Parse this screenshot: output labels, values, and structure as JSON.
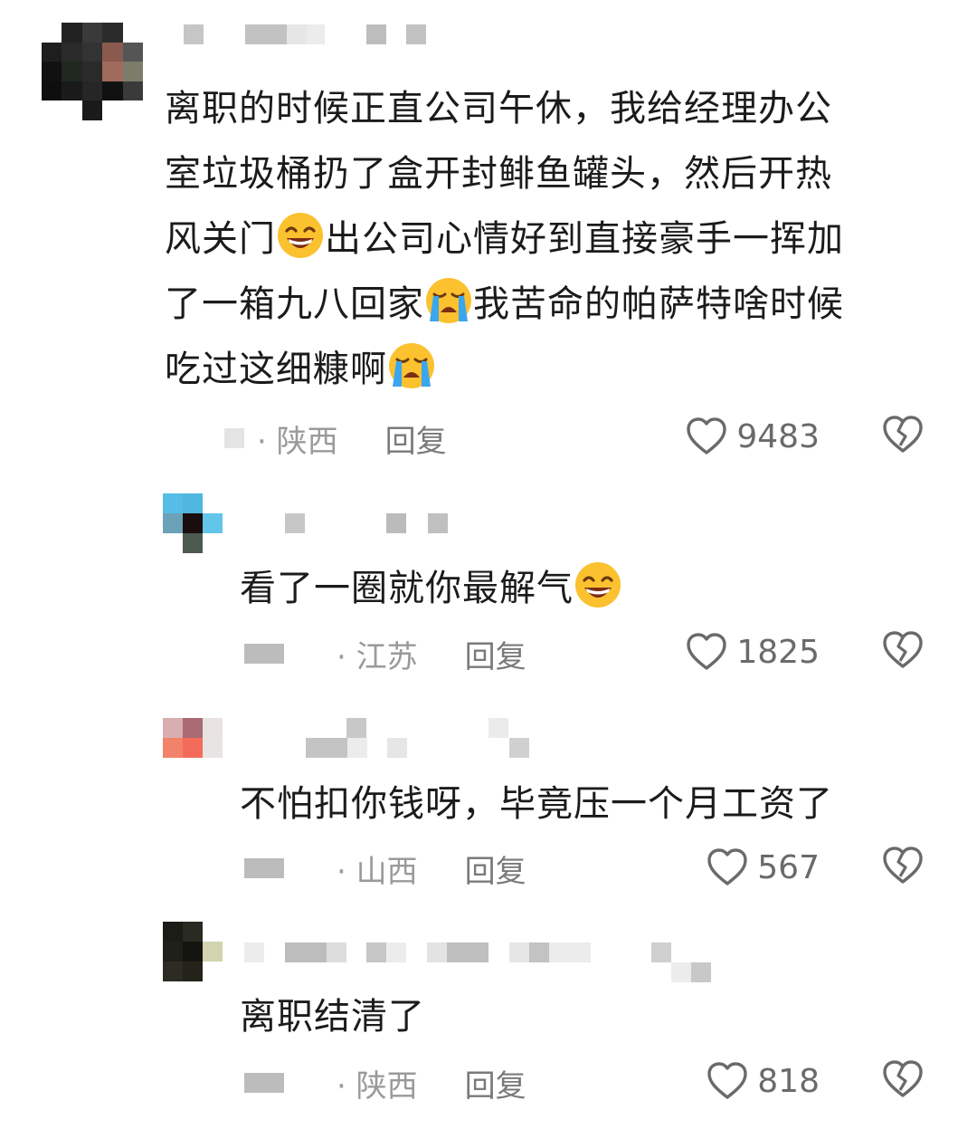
{
  "comments": [
    {
      "text_lines": [
        "离职的时候正直公司午休，我给经理办公",
        "室垃圾桶扔了盒开封鲱鱼罐头，然后开热",
        "风关门",
        "出公司心情好到直接豪手一挥加",
        "了一箱九八回家",
        "我苦命的帕萨特啥时候",
        "吃过这细糠啊"
      ],
      "location": "· 陕西",
      "reply": "回复",
      "likes": "9483"
    },
    {
      "text": "看了一圈就你最解气",
      "location": "· 江苏",
      "reply": "回复",
      "likes": "1825"
    },
    {
      "text": "不怕扣你钱呀，毕竟压一个月工资了",
      "location": "· 山西",
      "reply": "回复",
      "likes": "567"
    },
    {
      "text": "离职结清了",
      "location": "· 陕西",
      "reply": "回复",
      "likes": "818"
    }
  ],
  "icons": {
    "like": "heart-outline-icon",
    "dislike": "broken-heart-icon",
    "emoji_grin": "grinning-sweat-emoji",
    "emoji_cry": "crying-emoji"
  },
  "colors": {
    "text": "#1b1b1b",
    "meta": "#9a9a9a",
    "icon": "#6a6a6a"
  }
}
